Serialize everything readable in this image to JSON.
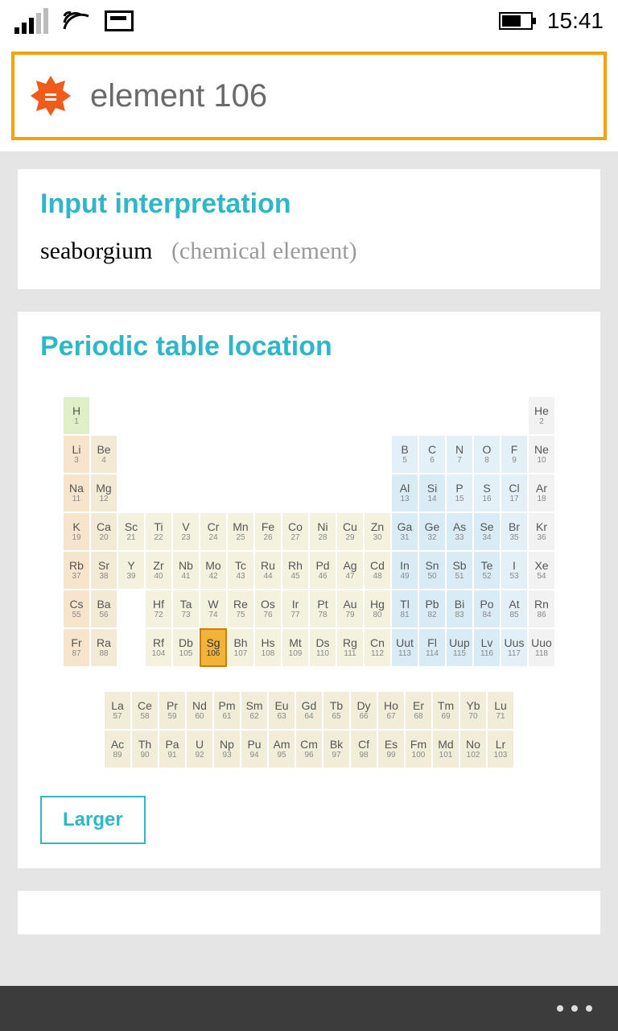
{
  "status": {
    "time": "15:41"
  },
  "search": {
    "value": "element 106"
  },
  "panel_interpretation": {
    "title": "Input interpretation",
    "name": "seaborgium",
    "qualifier": "(chemical element)"
  },
  "panel_ptable": {
    "title": "Periodic table location",
    "highlight_atomic_number": 106,
    "larger_label": "Larger"
  },
  "periodic_table": {
    "main_rows": [
      [
        [
          "H",
          1,
          "c0"
        ],
        null,
        null,
        null,
        null,
        null,
        null,
        null,
        null,
        null,
        null,
        null,
        null,
        null,
        null,
        null,
        null,
        [
          "He",
          2,
          "c6"
        ]
      ],
      [
        [
          "Li",
          3,
          "c1"
        ],
        [
          "Be",
          4,
          "c2"
        ],
        null,
        null,
        null,
        null,
        null,
        null,
        null,
        null,
        null,
        null,
        [
          "B",
          5,
          "c5"
        ],
        [
          "C",
          6,
          "c5"
        ],
        [
          "N",
          7,
          "c5"
        ],
        [
          "O",
          8,
          "c5"
        ],
        [
          "F",
          9,
          "c5"
        ],
        [
          "Ne",
          10,
          "c6"
        ]
      ],
      [
        [
          "Na",
          11,
          "c1"
        ],
        [
          "Mg",
          12,
          "c2"
        ],
        null,
        null,
        null,
        null,
        null,
        null,
        null,
        null,
        null,
        null,
        [
          "Al",
          13,
          "c4"
        ],
        [
          "Si",
          14,
          "c4"
        ],
        [
          "P",
          15,
          "c5"
        ],
        [
          "S",
          16,
          "c5"
        ],
        [
          "Cl",
          17,
          "c5"
        ],
        [
          "Ar",
          18,
          "c6"
        ]
      ],
      [
        [
          "K",
          19,
          "c1"
        ],
        [
          "Ca",
          20,
          "c2"
        ],
        [
          "Sc",
          21,
          "c3"
        ],
        [
          "Ti",
          22,
          "c3"
        ],
        [
          "V",
          23,
          "c3"
        ],
        [
          "Cr",
          24,
          "c3"
        ],
        [
          "Mn",
          25,
          "c3"
        ],
        [
          "Fe",
          26,
          "c3"
        ],
        [
          "Co",
          27,
          "c3"
        ],
        [
          "Ni",
          28,
          "c3"
        ],
        [
          "Cu",
          29,
          "c3"
        ],
        [
          "Zn",
          30,
          "c3"
        ],
        [
          "Ga",
          31,
          "c4"
        ],
        [
          "Ge",
          32,
          "c4"
        ],
        [
          "As",
          33,
          "c4"
        ],
        [
          "Se",
          34,
          "c4"
        ],
        [
          "Br",
          35,
          "c5"
        ],
        [
          "Kr",
          36,
          "c6"
        ]
      ],
      [
        [
          "Rb",
          37,
          "c1"
        ],
        [
          "Sr",
          38,
          "c2"
        ],
        [
          "Y",
          39,
          "c3"
        ],
        [
          "Zr",
          40,
          "c3"
        ],
        [
          "Nb",
          41,
          "c3"
        ],
        [
          "Mo",
          42,
          "c3"
        ],
        [
          "Tc",
          43,
          "c3"
        ],
        [
          "Ru",
          44,
          "c3"
        ],
        [
          "Rh",
          45,
          "c3"
        ],
        [
          "Pd",
          46,
          "c3"
        ],
        [
          "Ag",
          47,
          "c3"
        ],
        [
          "Cd",
          48,
          "c3"
        ],
        [
          "In",
          49,
          "c4"
        ],
        [
          "Sn",
          50,
          "c4"
        ],
        [
          "Sb",
          51,
          "c4"
        ],
        [
          "Te",
          52,
          "c4"
        ],
        [
          "I",
          53,
          "c5"
        ],
        [
          "Xe",
          54,
          "c6"
        ]
      ],
      [
        [
          "Cs",
          55,
          "c1"
        ],
        [
          "Ba",
          56,
          "c2"
        ],
        null,
        [
          "Hf",
          72,
          "c3"
        ],
        [
          "Ta",
          73,
          "c3"
        ],
        [
          "W",
          74,
          "c3"
        ],
        [
          "Re",
          75,
          "c3"
        ],
        [
          "Os",
          76,
          "c3"
        ],
        [
          "Ir",
          77,
          "c3"
        ],
        [
          "Pt",
          78,
          "c3"
        ],
        [
          "Au",
          79,
          "c3"
        ],
        [
          "Hg",
          80,
          "c3"
        ],
        [
          "Tl",
          81,
          "c4"
        ],
        [
          "Pb",
          82,
          "c4"
        ],
        [
          "Bi",
          83,
          "c4"
        ],
        [
          "Po",
          84,
          "c4"
        ],
        [
          "At",
          85,
          "c5"
        ],
        [
          "Rn",
          86,
          "c6"
        ]
      ],
      [
        [
          "Fr",
          87,
          "c1"
        ],
        [
          "Ra",
          88,
          "c2"
        ],
        null,
        [
          "Rf",
          104,
          "c3"
        ],
        [
          "Db",
          105,
          "c3"
        ],
        [
          "Sg",
          106,
          "c3"
        ],
        [
          "Bh",
          107,
          "c3"
        ],
        [
          "Hs",
          108,
          "c3"
        ],
        [
          "Mt",
          109,
          "c3"
        ],
        [
          "Ds",
          110,
          "c3"
        ],
        [
          "Rg",
          111,
          "c3"
        ],
        [
          "Cn",
          112,
          "c3"
        ],
        [
          "Uut",
          113,
          "c4"
        ],
        [
          "Fl",
          114,
          "c4"
        ],
        [
          "Uup",
          115,
          "c4"
        ],
        [
          "Lv",
          116,
          "c4"
        ],
        [
          "Uus",
          117,
          "c5"
        ],
        [
          "Uuo",
          118,
          "c6"
        ]
      ]
    ],
    "f_block": [
      [
        [
          "La",
          57,
          "c7"
        ],
        [
          "Ce",
          58,
          "c7"
        ],
        [
          "Pr",
          59,
          "c7"
        ],
        [
          "Nd",
          60,
          "c7"
        ],
        [
          "Pm",
          61,
          "c7"
        ],
        [
          "Sm",
          62,
          "c7"
        ],
        [
          "Eu",
          63,
          "c7"
        ],
        [
          "Gd",
          64,
          "c7"
        ],
        [
          "Tb",
          65,
          "c7"
        ],
        [
          "Dy",
          66,
          "c7"
        ],
        [
          "Ho",
          67,
          "c7"
        ],
        [
          "Er",
          68,
          "c7"
        ],
        [
          "Tm",
          69,
          "c7"
        ],
        [
          "Yb",
          70,
          "c7"
        ],
        [
          "Lu",
          71,
          "c7"
        ]
      ],
      [
        [
          "Ac",
          89,
          "c7"
        ],
        [
          "Th",
          90,
          "c7"
        ],
        [
          "Pa",
          91,
          "c7"
        ],
        [
          "U",
          92,
          "c7"
        ],
        [
          "Np",
          93,
          "c7"
        ],
        [
          "Pu",
          94,
          "c7"
        ],
        [
          "Am",
          95,
          "c7"
        ],
        [
          "Cm",
          96,
          "c7"
        ],
        [
          "Bk",
          97,
          "c7"
        ],
        [
          "Cf",
          98,
          "c7"
        ],
        [
          "Es",
          99,
          "c7"
        ],
        [
          "Fm",
          100,
          "c7"
        ],
        [
          "Md",
          101,
          "c7"
        ],
        [
          "No",
          102,
          "c7"
        ],
        [
          "Lr",
          103,
          "c7"
        ]
      ]
    ]
  }
}
